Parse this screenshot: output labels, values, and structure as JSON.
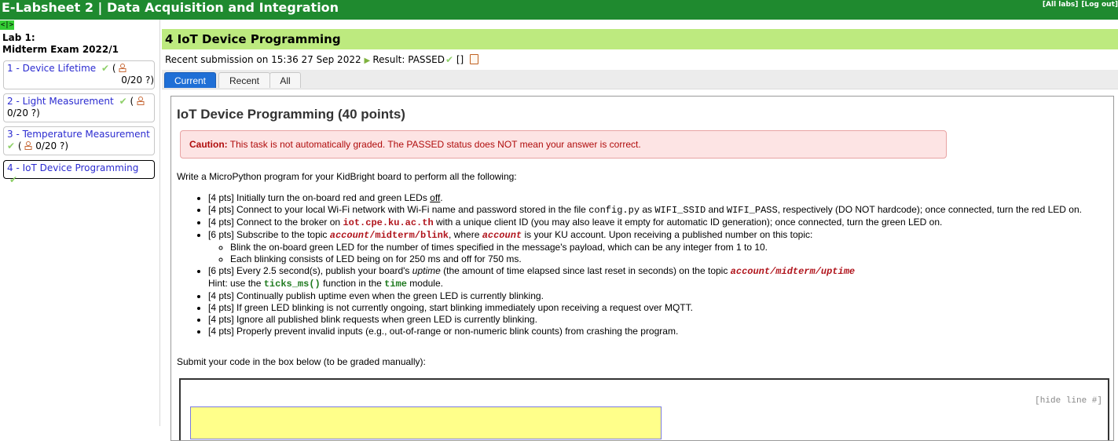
{
  "app": {
    "title": "E-Labsheet 2 | Data Acquisition and Integration",
    "links": [
      "[All labs]",
      "[Log out]"
    ],
    "toggle": "<|>"
  },
  "sidebar": {
    "lab_line1": "Lab 1:",
    "lab_line2": "Midterm Exam 2022/1",
    "items": [
      {
        "name": "1 - Device Lifetime",
        "score": "0/20 ?)",
        "open": "("
      },
      {
        "name": "2 - Light Measurement",
        "score": "0/20 ?)",
        "open": "("
      },
      {
        "name": "3 - Temperature Measurement",
        "score": "0/20 ?)",
        "open": "("
      },
      {
        "name": "4 - IoT Device Programming"
      }
    ]
  },
  "task": {
    "header": "4 IoT Device Programming",
    "submission_prefix": "Recent submission on 15:36 27 Sep 2022",
    "result": "Result: PASSED",
    "brackets": "[]"
  },
  "tabs": [
    "Current",
    "Recent",
    "All"
  ],
  "content": {
    "heading": "IoT Device Programming (40 points)",
    "caution_label": "Caution:",
    "caution_text": " This task is not automatically graded. The PASSED status does NOT mean your answer is correct.",
    "intro": "Write a MicroPython program for your KidBright board to perform all the following:",
    "submit_text": "Submit your code in the box below (to be graded manually):",
    "hide_line": "[hide line #]"
  },
  "colors": {
    "topbar": "#1f8a2f",
    "task_header": "#bdea7f",
    "active_tab": "#1f6fd6",
    "caution_bg": "#fde4e4",
    "code_area": "#ffff8a"
  }
}
